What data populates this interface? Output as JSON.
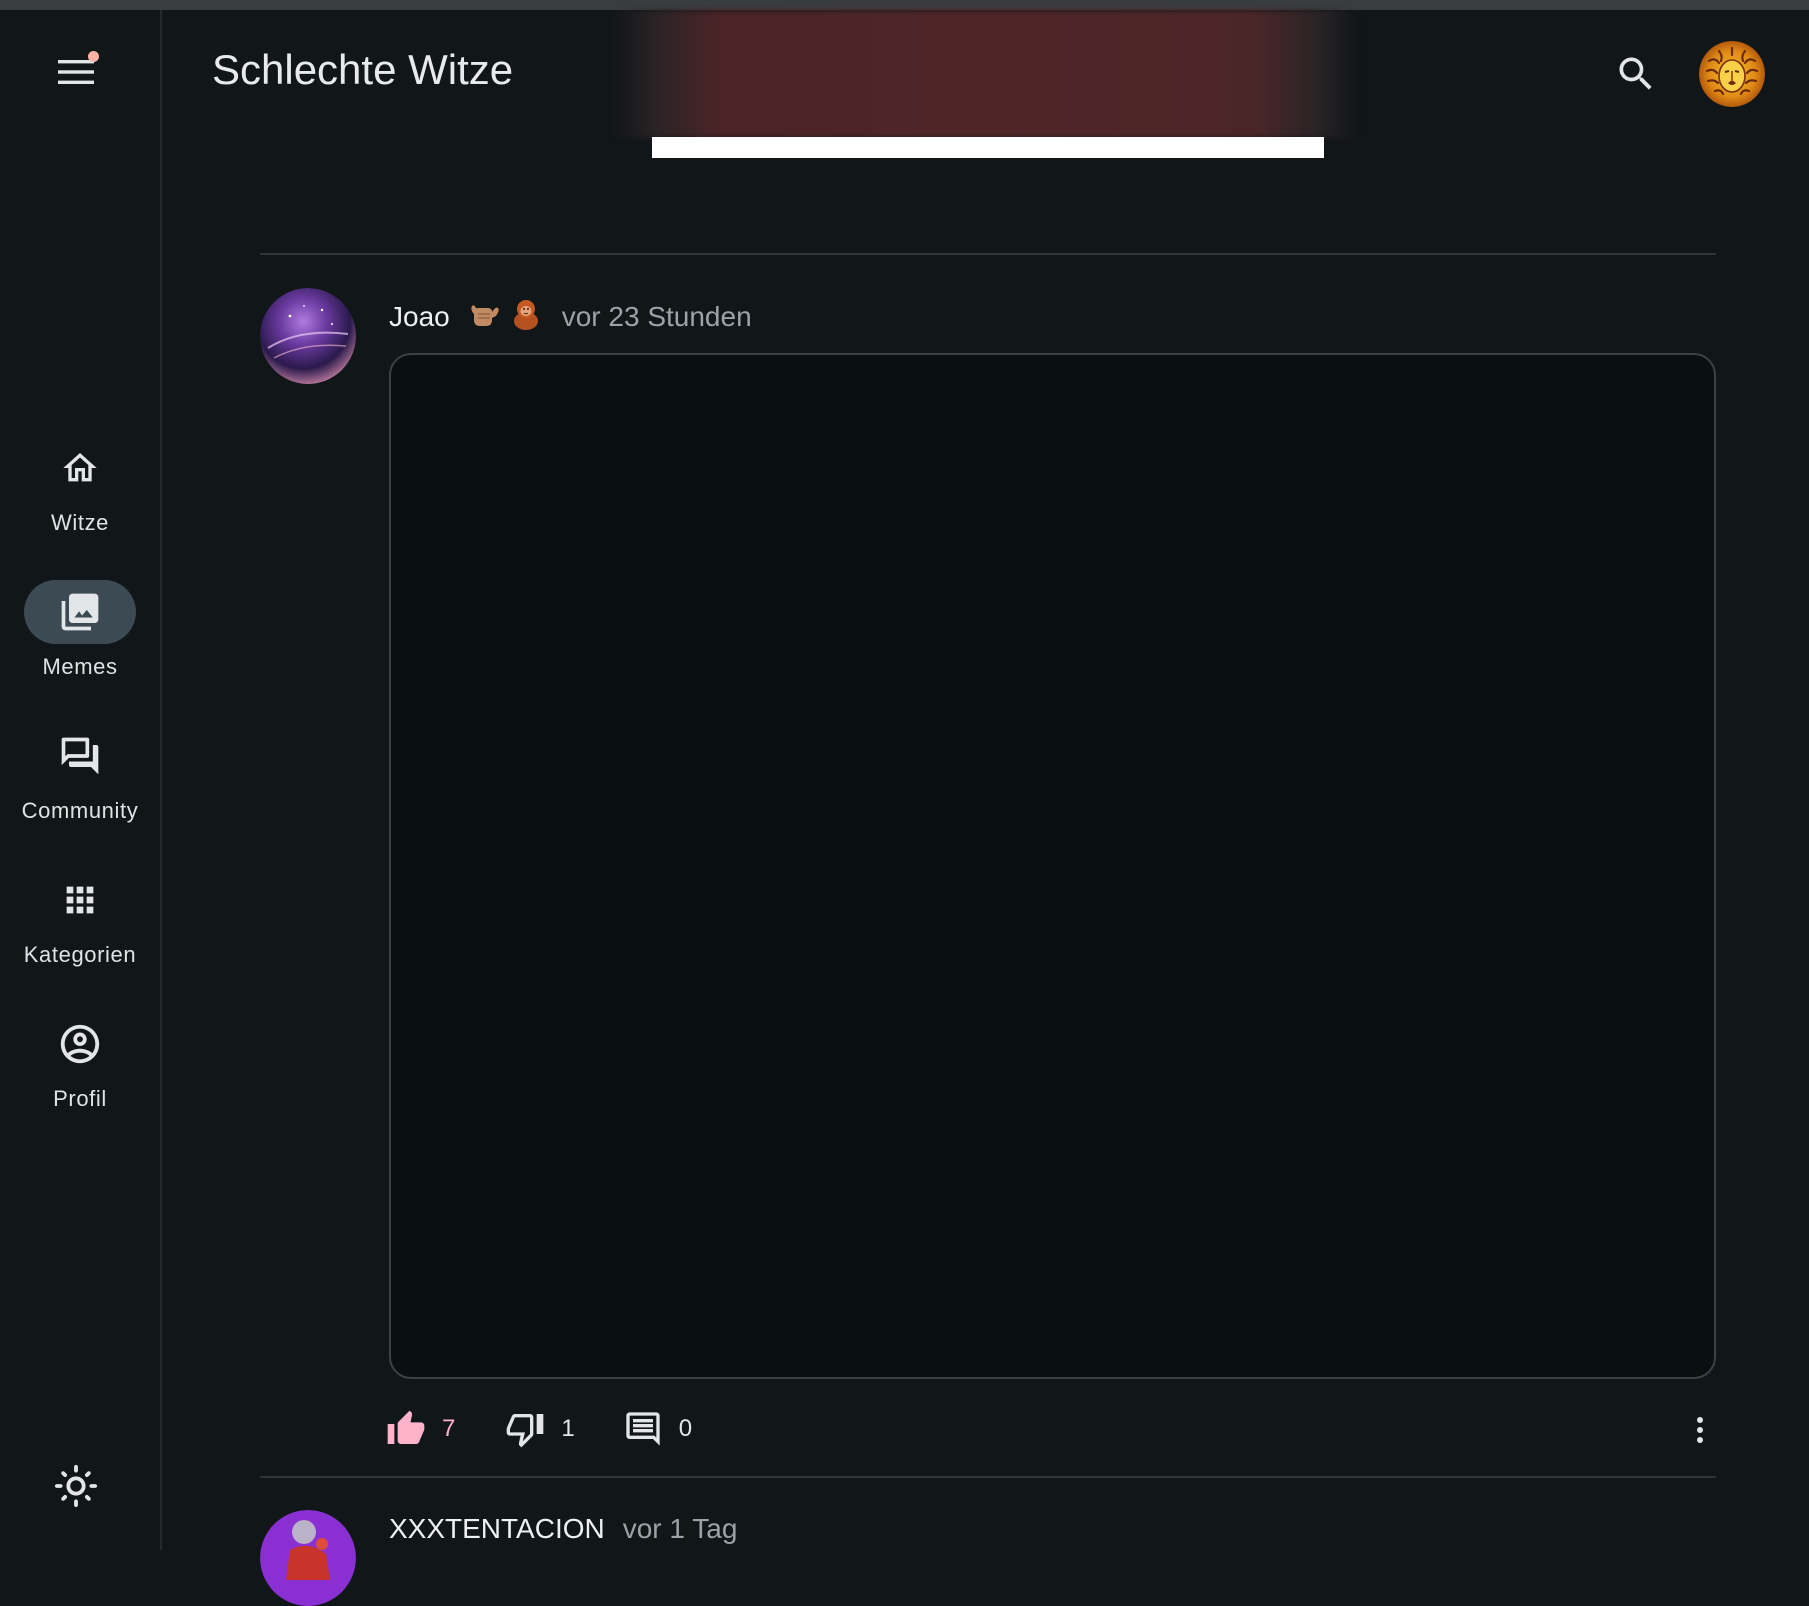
{
  "app": {
    "title": "Schlechte Witze"
  },
  "nav": [
    {
      "label": "Witze",
      "icon": "home-icon",
      "active": false
    },
    {
      "label": "Memes",
      "icon": "photo-library-icon",
      "active": true
    },
    {
      "label": "Community",
      "icon": "forum-icon",
      "active": false
    },
    {
      "label": "Kategorien",
      "icon": "apps-grid-icon",
      "active": false
    },
    {
      "label": "Profil",
      "icon": "account-circle-icon",
      "active": false
    }
  ],
  "header": {
    "menu_icon": "menu-icon",
    "search_icon": "search-icon",
    "avatar": "lion-avatar",
    "theme_icon": "sun-icon"
  },
  "posts": [
    {
      "author": "Joao",
      "author_emojis": "🤙🏽🦧",
      "time": "vor 23 Stunden",
      "likes": "7",
      "dislikes": "1",
      "comments": "0"
    },
    {
      "author": "XXXTENTACION",
      "time": "vor 1 Tag"
    }
  ],
  "colors": {
    "background": "#111619",
    "accent_like": "#ffb2c9",
    "active_nav": "#3c4a54",
    "notification_dot": "#ffb4a6"
  }
}
